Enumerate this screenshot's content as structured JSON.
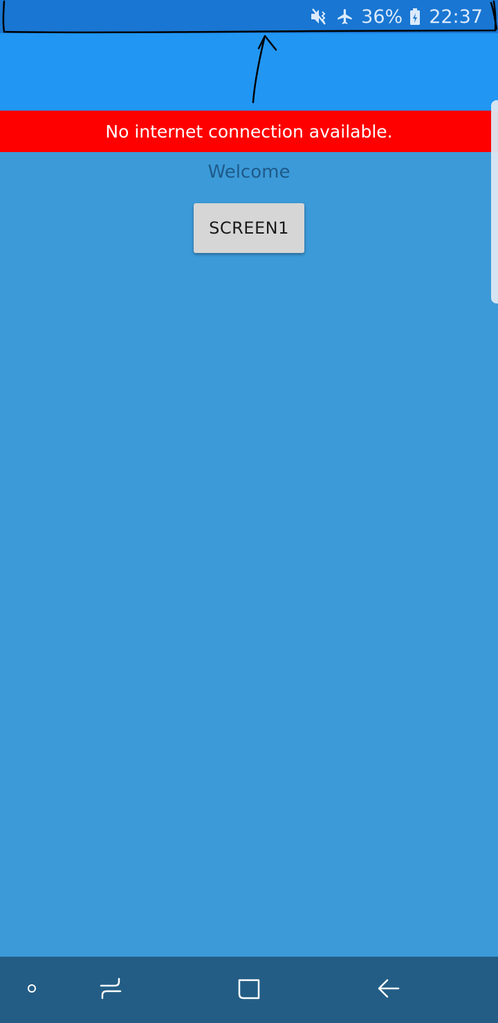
{
  "status_bar": {
    "mute_icon": "vibrate-mute-icon",
    "airplane_icon": "airplane-icon",
    "battery_percent": "36%",
    "battery_icon": "battery-charging-icon",
    "time": "22:37"
  },
  "banner": {
    "message": "No internet connection available.",
    "color": "#ff0000"
  },
  "content": {
    "welcome_text": "Welcome",
    "screen1_button_label": "SCREEN1"
  },
  "nav_bar": {
    "items": [
      {
        "icon": "dot-icon"
      },
      {
        "icon": "recent-apps-icon"
      },
      {
        "icon": "home-icon"
      },
      {
        "icon": "back-icon"
      }
    ]
  },
  "colors": {
    "status_bar": "#1976d2",
    "app_bar": "#2196f3",
    "content_bg": "#3c9ad8",
    "nav_bar": "#235d85"
  }
}
